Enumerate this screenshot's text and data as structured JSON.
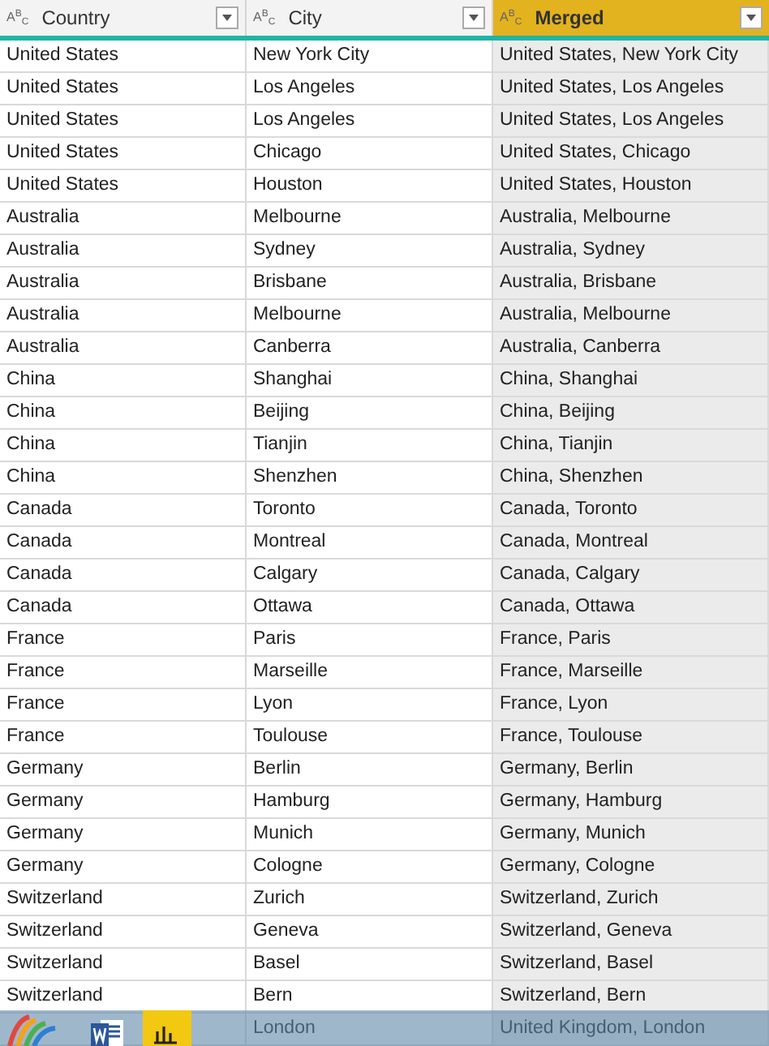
{
  "table": {
    "columns": [
      {
        "label": "Country",
        "type_icon": "A$^{B}$$_{C}$",
        "selected": false
      },
      {
        "label": "City",
        "type_icon": "A$^{B}$$_{C}$",
        "selected": false
      },
      {
        "label": "Merged",
        "type_icon": "A$^{B}$$_{C}$",
        "selected": true
      }
    ],
    "rows": [
      [
        "United States",
        "New York City",
        "United States, New York City"
      ],
      [
        "United States",
        "Los Angeles",
        "United States, Los Angeles"
      ],
      [
        "United States",
        "Los Angeles",
        "United States, Los Angeles"
      ],
      [
        "United States",
        "Chicago",
        "United States, Chicago"
      ],
      [
        "United States",
        "Houston",
        "United States, Houston"
      ],
      [
        "Australia",
        "Melbourne",
        "Australia, Melbourne"
      ],
      [
        "Australia",
        "Sydney",
        "Australia, Sydney"
      ],
      [
        "Australia",
        "Brisbane",
        "Australia, Brisbane"
      ],
      [
        "Australia",
        "Melbourne",
        "Australia, Melbourne"
      ],
      [
        "Australia",
        "Canberra",
        "Australia, Canberra"
      ],
      [
        "China",
        "Shanghai",
        "China, Shanghai"
      ],
      [
        "China",
        "Beijing",
        "China, Beijing"
      ],
      [
        "China",
        "Tianjin",
        "China, Tianjin"
      ],
      [
        "China",
        "Shenzhen",
        "China, Shenzhen"
      ],
      [
        "Canada",
        "Toronto",
        "Canada, Toronto"
      ],
      [
        "Canada",
        "Montreal",
        "Canada, Montreal"
      ],
      [
        "Canada",
        "Calgary",
        "Canada, Calgary"
      ],
      [
        "Canada",
        "Ottawa",
        "Canada, Ottawa"
      ],
      [
        "France",
        "Paris",
        "France, Paris"
      ],
      [
        "France",
        "Marseille",
        "France, Marseille"
      ],
      [
        "France",
        "Lyon",
        "France, Lyon"
      ],
      [
        "France",
        "Toulouse",
        "France, Toulouse"
      ],
      [
        "Germany",
        "Berlin",
        "Germany, Berlin"
      ],
      [
        "Germany",
        "Hamburg",
        "Germany, Hamburg"
      ],
      [
        "Germany",
        "Munich",
        "Germany, Munich"
      ],
      [
        "Germany",
        "Cologne",
        "Germany, Cologne"
      ],
      [
        "Switzerland",
        "Zurich",
        "Switzerland, Zurich"
      ],
      [
        "Switzerland",
        "Geneva",
        "Switzerland, Geneva"
      ],
      [
        "Switzerland",
        "Basel",
        "Switzerland, Basel"
      ],
      [
        "Switzerland",
        "Bern",
        "Switzerland, Bern"
      ],
      [
        "",
        "London",
        "United Kingdom, London"
      ]
    ]
  },
  "taskbar": {
    "apps": [
      {
        "kind": "swirl"
      },
      {
        "kind": "word"
      },
      {
        "kind": "chart"
      }
    ]
  }
}
